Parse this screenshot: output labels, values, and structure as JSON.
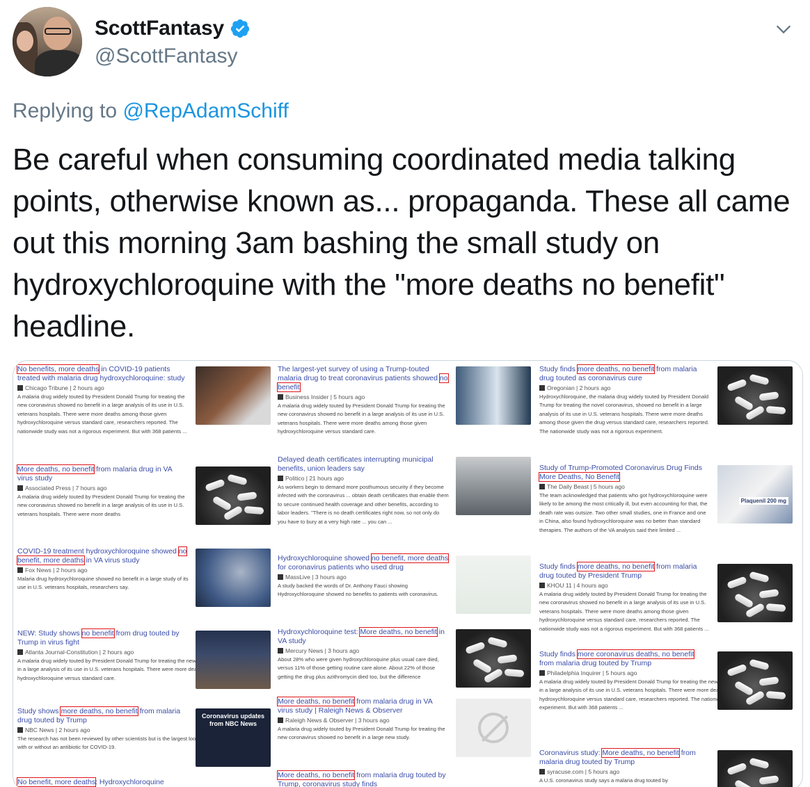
{
  "author": {
    "display_name": "ScottFantasy",
    "handle": "@ScottFantasy"
  },
  "reply": {
    "prefix": "Replying to ",
    "mention": "@RepAdamSchiff"
  },
  "tweet": {
    "text": "Be careful when consuming coordinated media talking points, otherwise known as... propaganda. These all came out this morning 3am bashing the small study on hydroxychloroquine with the \"more deaths no benefit\" headline."
  },
  "icons": {
    "verified": "verified-badge-icon",
    "caret": "chevron-down-icon"
  },
  "colors": {
    "accent": "#1b95e0",
    "muted": "#657786",
    "highlight_box": "#e0141a"
  },
  "media": {
    "col1": [
      {
        "pre": "",
        "hl": "No benefits, more deaths",
        "post": " in COVID-19 patients treated with malaria drug hydroxychloroquine: study",
        "source": "Chicago Tribune | 2 hours ago",
        "snippet": "A malaria drug widely touted by President Donald Trump for treating the new coronavirus showed no benefit in a large analysis of its use in U.S. veterans hospitals. There were more deaths among those given hydroxychloroquine versus standard care, researchers reported. The nationwide study was not a rigorous experiment. But with 368 patients ..."
      },
      {
        "pre": "",
        "hl": "More deaths, no benefit",
        "post": " from malaria drug in VA virus study",
        "source": "Associated Press | 7 hours ago",
        "snippet": "A malaria drug widely touted by President Donald Trump for treating the new coronavirus showed no benefit in a large analysis of its use in U.S. veterans hospitals. There were more deaths"
      },
      {
        "pre": "COVID-19 treatment hydroxychloroquine showed ",
        "hl": "no benefit, more deaths",
        "post": " in VA virus study",
        "source": "Fox News | 2 hours ago",
        "snippet": "Malaria drug hydroxychloroquine showed no benefit in a large study of its use in U.S. veterans hospitals, researchers say."
      },
      {
        "pre": "NEW: Study shows ",
        "hl": "no benefit",
        "post": " from drug touted by Trump in virus fight",
        "source": "Atlanta Journal-Constitution | 2 hours ago",
        "snippet": "A malaria drug widely touted by President Donald Trump for treating the new coronavirus showed no benefit in a large analysis of its use in U.S. veterans hospitals. There were more deaths among those given hydroxychloroquine versus standard care."
      },
      {
        "pre": "Study shows ",
        "hl": "more deaths, no benefit",
        "post": " from malaria drug touted by Trump",
        "source": "NBC News | 2 hours ago",
        "snippet": "The research has not been reviewed by other scientists but is the largest look so far of hydroxychloroquine with or without an antibiotic for COVID-19."
      },
      {
        "pre": "",
        "hl": "No benefit, more deaths",
        "post": ": Hydroxychloroquine",
        "source": "",
        "snippet": ""
      }
    ],
    "col2": [
      {
        "pre": "The largest-yet survey of using a Trump-touted malaria drug to treat coronavirus patients showed ",
        "hl": "no benefit",
        "post": "",
        "source": "Business Insider | 5 hours ago",
        "snippet": "A malaria drug widely touted by President Donald Trump for treating the new coronavirus showed no benefit in a large analysis of its use in U.S. veterans hospitals. There were more deaths among those given hydroxychloroquine versus standard care."
      },
      {
        "pre": "Delayed death certificates interrupting municipal benefits, union leaders say",
        "hl": "",
        "post": "",
        "source": "Politico | 21 hours ago",
        "snippet": "As workers begin to demand more posthumous security if they become infected with the coronavirus ... obtain death certificates that enable them to secure continued health coverage and other benefits, according to labor leaders. \"There is no death certificates right now, so not only do you have to bury at a very high rate ... you can ..."
      },
      {
        "pre": "Hydroxychloroquine showed ",
        "hl": "no benefit, more deaths",
        "post": " for coronavirus patients who used drug",
        "source": "MassLive | 3 hours ago",
        "snippet": "A study backed the words of Dr. Anthony Fauci showing Hydroxychloroquine showed no benefits to patients with coronavirus."
      },
      {
        "pre": "Hydroxychloroquine test: ",
        "hl": "More deaths, no benefit",
        "post": " in VA study",
        "source": "Mercury News | 3 hours ago",
        "snippet": "About 28% who were given hydroxychloroquine plus usual care died, versus 11% of those getting routine care alone. About 22% of those getting the drug plus azithromycin died too, but the difference"
      },
      {
        "pre": "",
        "hl": "More deaths, no benefit",
        "post": " from malaria drug in VA virus study | Raleigh News & Observer",
        "source": "Raleigh News & Observer | 3 hours ago",
        "snippet": "A malaria drug widely touted by President Donald Trump for treating the new coronavirus showed no benefit in a large new study."
      },
      {
        "pre": "",
        "hl": "More deaths, no benefit",
        "post": " from malaria drug touted by Trump, coronavirus study finds",
        "source": "",
        "snippet": ""
      }
    ],
    "col3": [
      {
        "pre": "Study finds ",
        "hl": "more deaths, no benefit",
        "post": " from malaria drug touted as coronavirus cure",
        "source": "Oregonian | 2 hours ago",
        "snippet": "Hydroxychloroquine, the malaria drug widely touted by President Donald Trump for treating the novel coronavirus, showed no benefit in a large analysis of its use in U.S. veterans hospitals. There were more deaths among those given the drug versus standard care, researchers reported. The nationwide study was not a rigorous experiment."
      },
      {
        "pre": "Study of Trump-Promoted Coronavirus Drug Finds ",
        "hl": "More Deaths, No Benefit",
        "post": "",
        "source": "The Daily Beast | 5 hours ago",
        "snippet": "The team acknowledged that patients who got hydroxychloroquine were likely to be among the most critically ill, but even accounting for that, the death rate was outsize. Two other small studies, one in France and one in China, also found hydroxychloroquine was no better than standard therapies. The authors of the VA analysis said their limited ..."
      },
      {
        "pre": "Study finds ",
        "hl": "more deaths, no benefit",
        "post": " from malaria drug touted by President Trump",
        "source": "KHOU 11 | 4 hours ago",
        "snippet": "A malaria drug widely touted by President Donald Trump for treating the new coronavirus showed no benefit in a large analysis of its use in U.S. veterans hospitals. There were more deaths among those given hydroxychloroquine versus standard care, researchers reported. The nationwide study was not a rigorous experiment. But with 368 patients ..."
      },
      {
        "pre": "Study finds ",
        "hl": "more coronavirus deaths, no benefit",
        "post": " from malaria drug touted by Trump",
        "source": "Philadelphia Inquirer | 5 hours ago",
        "snippet": "A malaria drug widely touted by President Donald Trump for treating the new coronavirus showed no benefit in a large analysis of its use in U.S. veterans hospitals. There were more deaths among those given hydroxychloroquine versus standard care, researchers reported. The nationwide study was not a rigorous experiment. But with 368 patients ..."
      },
      {
        "pre": "Coronavirus study: ",
        "hl": "More deaths, no benefit",
        "post": " from malaria drug touted by Trump",
        "source": "syracuse.com | 5 hours ago",
        "snippet": "A U.S. coronavirus study says a malaria drug touted by"
      }
    ],
    "thumb_labels": {
      "nbc": "Coronavirus updates from NBC News",
      "plaquenil": "Plaquenil 200 mg"
    }
  }
}
